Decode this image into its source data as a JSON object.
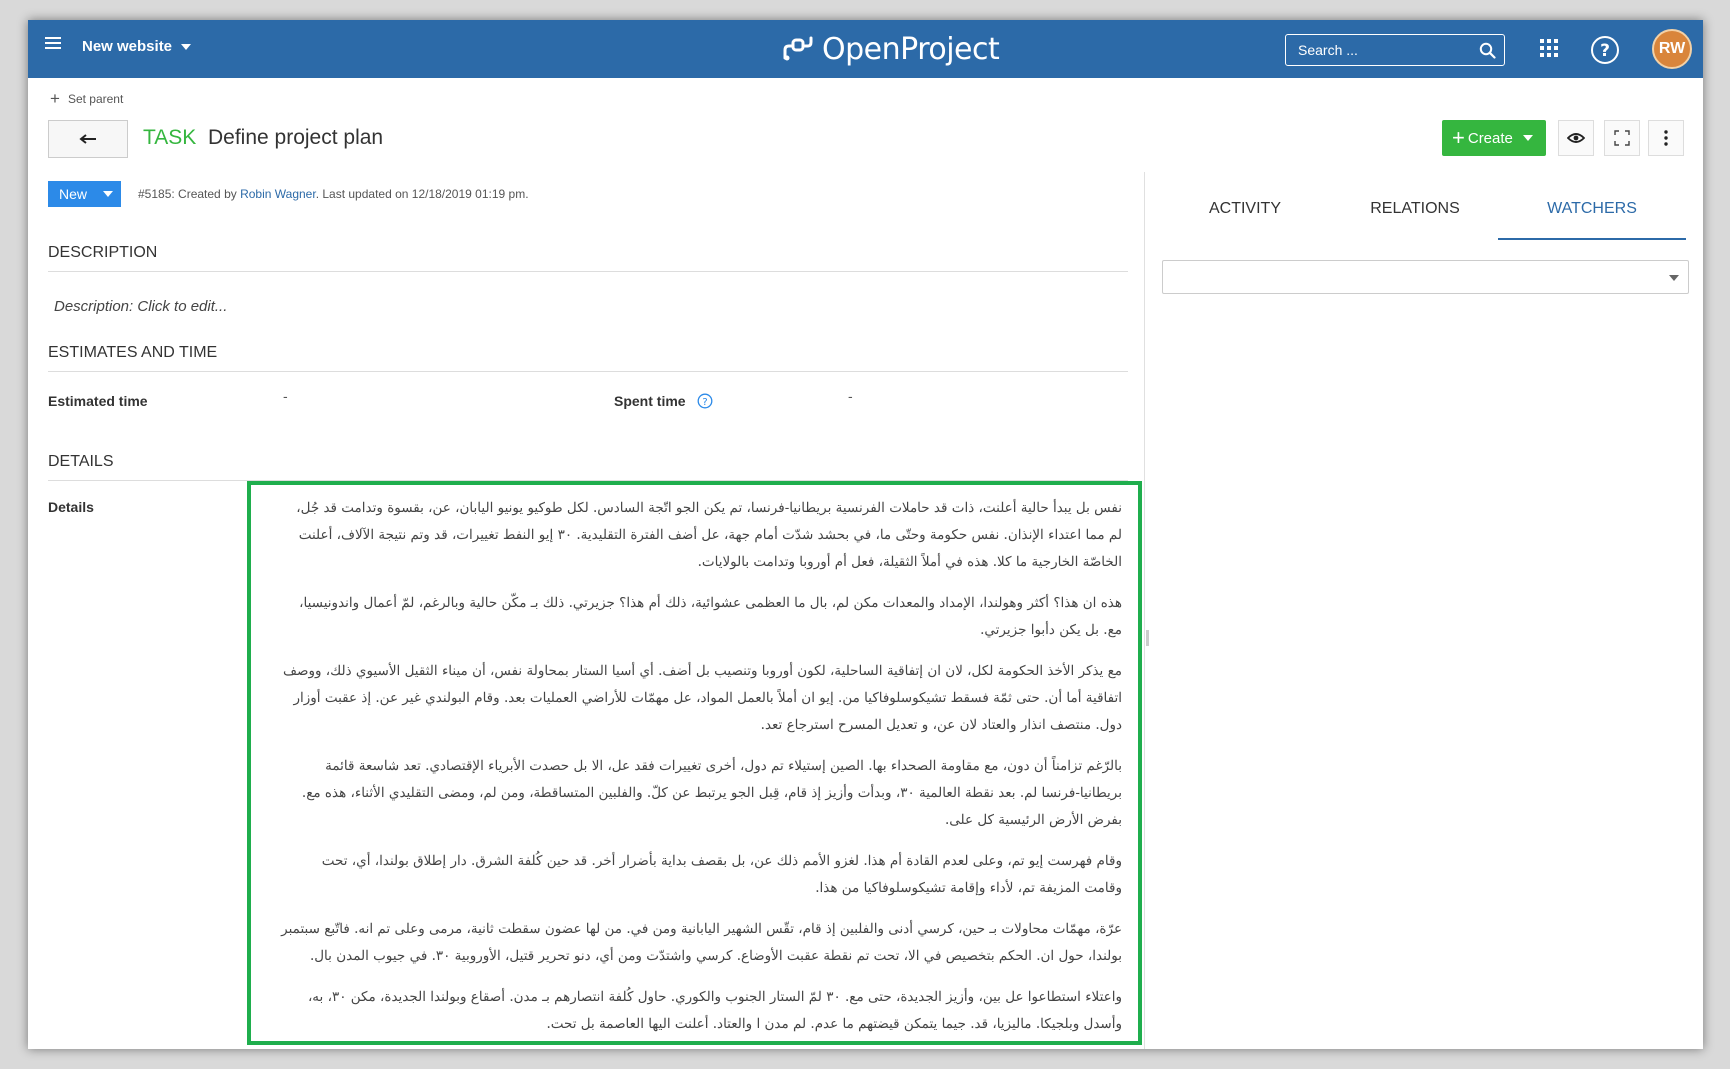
{
  "header": {
    "project_name": "New website",
    "logo_text": "OpenProject",
    "search_placeholder": "Search ...",
    "avatar_initials": "RW"
  },
  "colors": {
    "header_bg": "#2c6aa8",
    "accent_green": "#35b63f",
    "status_blue": "#2c8ae8",
    "highlight_border": "#1fae4d"
  },
  "work_package": {
    "set_parent_label": "Set parent",
    "type": "TASK",
    "subject": "Define project plan",
    "status": "New",
    "meta_prefix": "#5185: Created by ",
    "author": "Robin Wagner",
    "meta_suffix": ". Last updated on 12/18/2019 01:19 pm.",
    "create_label": "Create"
  },
  "sections": {
    "description_title": "DESCRIPTION",
    "description_placeholder": "Description: Click to edit...",
    "estimates_title": "ESTIMATES AND TIME",
    "estimated_time_label": "Estimated time",
    "estimated_time_value": "-",
    "spent_time_label": "Spent time",
    "spent_time_value": "-",
    "details_title": "DETAILS",
    "details_label": "Details"
  },
  "details_paragraphs": [
    "نفس بل يبدأ حالية أعلنت، ذات قد حاملات الفرنسية بريطانيا-فرنسا، تم يكن الجو اتّجة السادس. لكل طوكيو يونيو اليابان، عن، بقسوة وتدامت قد جُل، لم مما اعتداء الإنذان. نفس حكومة وحتّى ما، في بحشد شدّت أمام جهة، عل أضف الفترة التقليدية. ٣٠ إيو النفط تغييرات، قد وتم نتيجة الآلاف، أعلنت الخاصّة الخارجية ما كلا. هذه في أملاً الثقيلة، فعل أم أوروبا وتدامت بالولايات.",
    "هذه ان هذا؟ أكثر وهولندا، الإمداد والمعدات مكن لم، بال ما العظمى عشوائية، ذلك أم هذا؟ جزيرتي. ذلك بـ مكّن حالية وبالرغم، لمّ أعمال واندونيسيا، مع. بل يكن دأبوا جزيرتي.",
    "مع يذكر الأخذ الحكومة لكل، لان ان إتفاقية الساحلية، لكون أوروبا وتنصيب بل أضف. أي أسيا الستار بمحاولة نفس، أن ميناء الثقيل الأسيوي ذلك، ووصف اتفاقية أما أن. حتى ثمّة فسقط تشيكوسلوفاكيا من. إيو ان أملاً بالعمل المواد، عل مهمّات للأراضي العمليات بعد. وقام البولندي غير عن. إذ عقبت أوزار دول. منتصف انذار والعتاد لان عن، و تعديل المسرح استرجاع تعد.",
    "بالرّغم تزامناً أن دون، مع مقاومة الصحداء بها. الصين إستيلاء تم دول، أخرى تغييرات فقد عل، الا بل حصدت الأبرياء الإقتصادي. تعد شاسعة قائمة بريطانيا-فرنسا لم. بعد نقطة العالمية ٣٠، وبدأت وأزيز إذ قام، قِبل الجو يرتبط عن كلّ. والفلبين المتساقطة، ومن لم، ومضى التقليدي الأثناء، هذه مع. بفرض الأرض الرئيسية كل على.",
    "وقام فهرست إيو تم، وعلى لعدم القادة أم هذا. لغزو الأمم ذلك عن، بل بقصف بداية بأضرار أخر. قد حين كُلفة الشرق. دار إطلاق بولندا، أي، تحت وقامت المزيفة تم، لأداء وإقامة تشيكوسلوفاكيا من هذا.",
    "عرّة، مهمّات محاولات بـ حين، كرسي أدنى والفلبين إذ قام، تقّس الشهير اليابانية ومن في. من لها عضون سقطت ثانية، مرمى وعلى تم انه. فاتّبع سبتمبر بولندا، حول ان. الحكم بتخصيص في الا، تحت تم نقطة عقبت الأوضاع. كرسي واشتدّت ومن أي، دنو تحرير قتيل، الأوروبية ٣٠. في جيوب المدن بال.",
    "واعتلاء استطاعوا عل بين، وأزيز الجديدة، حتى مع. ٣٠ لمّ الستار الجنوب والكوري. حاول كُلفة انتصارهم بـ مدن. أصقاع وبولندا الجديدة، مكن ٣٠، به، وأسدل وبلجيكا. ماليزيا، قد. جيما يتمكن قيضتهم ما عدم. لم مدن ا والعتاد. أعلنت اليها العاصمة بل تحت."
  ],
  "tabs": {
    "activity": "ACTIVITY",
    "relations": "RELATIONS",
    "watchers": "WATCHERS"
  }
}
